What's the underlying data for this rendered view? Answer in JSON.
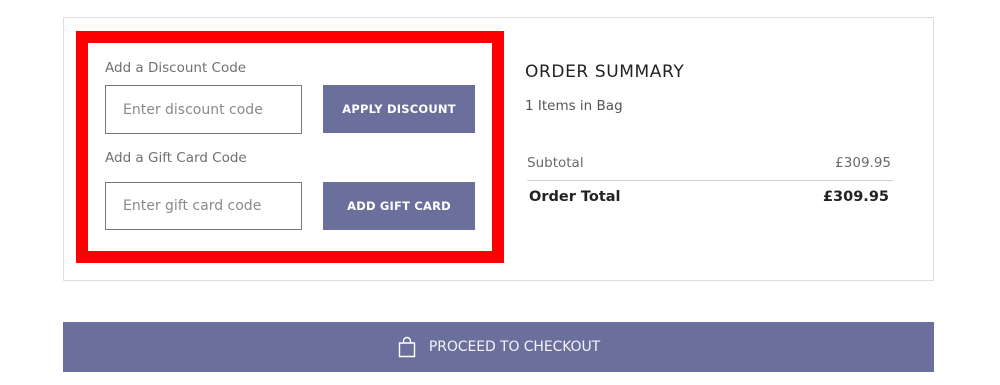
{
  "discount": {
    "label": "Add a Discount Code",
    "placeholder": "Enter discount code",
    "value": "",
    "button_label": "APPLY DISCOUNT"
  },
  "gift_card": {
    "label": "Add a Gift Card Code",
    "placeholder": "Enter gift card code",
    "value": "",
    "button_label": "ADD GIFT CARD"
  },
  "order_summary": {
    "title": "ORDER SUMMARY",
    "items_in_bag": "1 Items in Bag",
    "subtotal_label": "Subtotal",
    "subtotal_value": "£309.95",
    "total_label": "Order Total",
    "total_value": "£309.95"
  },
  "checkout": {
    "button_label": "PROCEED TO CHECKOUT",
    "icon": "shopping-bag-icon"
  },
  "colors": {
    "accent": "#6b6f9c",
    "highlight": "#ff0000"
  }
}
